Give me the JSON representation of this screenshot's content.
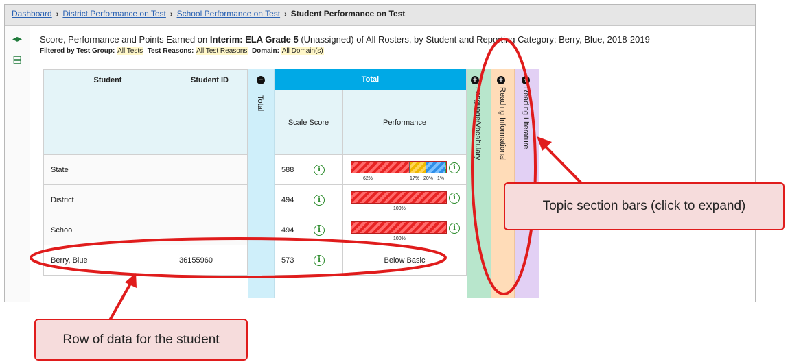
{
  "breadcrumb": {
    "items": [
      "Dashboard",
      "District Performance on Test",
      "School Performance on Test"
    ],
    "current": "Student Performance on Test",
    "separator": "›"
  },
  "header": {
    "title_prefix": "Score, Performance and Points Earned on ",
    "title_bold": "Interim: ELA Grade 5",
    "title_suffix": " (Unassigned) of All Rosters, by Student and Reporting Category: Berry, Blue, 2018-2019"
  },
  "filters": {
    "test_group_label": "Filtered by Test Group:",
    "test_group_value": "All Tests",
    "test_reasons_label": "Test Reasons:",
    "test_reasons_value": "All Test Reasons",
    "domain_label": "Domain:",
    "domain_value": "All Domain(s)"
  },
  "table": {
    "col_student": "Student",
    "col_student_id": "Student ID",
    "collapsed_total_label": "Total",
    "total_header": "Total",
    "sub_scale_score": "Scale Score",
    "sub_performance": "Performance",
    "collapse_glyph": "−",
    "expand_glyph": "+",
    "rows": [
      {
        "name": "State",
        "id": "",
        "score": "588",
        "perf_labels": [
          "62%",
          "17%",
          "20%",
          "1%"
        ]
      },
      {
        "name": "District",
        "id": "",
        "score": "494",
        "perf_labels": [
          "100%"
        ]
      },
      {
        "name": "School",
        "id": "",
        "score": "494",
        "perf_labels": [
          "100%"
        ]
      },
      {
        "name": "Berry, Blue",
        "id": "36155960",
        "score": "573",
        "perf_text": "Below Basic"
      }
    ],
    "info_glyph": "i",
    "topics": [
      "Language/Vocabulary",
      "Reading Informational",
      "Reading Literature"
    ]
  },
  "performance_levels": [
    {
      "row": "State",
      "fractions": [
        0.62,
        0.17,
        0.2,
        0.01
      ]
    },
    {
      "row": "District",
      "fractions": [
        1.0
      ]
    },
    {
      "row": "School",
      "fractions": [
        1.0
      ]
    }
  ],
  "callouts": {
    "topic": "Topic section bars (click to expand)",
    "row": "Row of data for the student"
  },
  "rail": {
    "expand_icon": "◂▸",
    "clipboard_icon": "▤"
  },
  "colors": {
    "total_header": "#00a9e6",
    "annotation": "#e01c1c",
    "topic1": "#b8e6cc",
    "topic2": "#ffdcb8",
    "topic3": "#e2d0f4"
  }
}
